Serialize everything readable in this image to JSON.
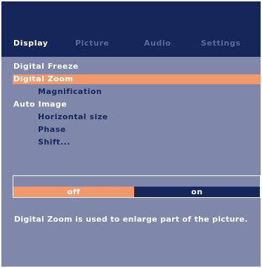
{
  "tabs": [
    {
      "label": "Display",
      "active": true
    },
    {
      "label": "Picture",
      "active": false
    },
    {
      "label": "Audio",
      "active": false
    },
    {
      "label": "Settings",
      "active": false
    }
  ],
  "menu": {
    "items": [
      {
        "label": "Digital Freeze",
        "level": 0,
        "highlighted": false
      },
      {
        "label": "Digital Zoom",
        "level": 0,
        "highlighted": true
      },
      {
        "label": "Magnification",
        "level": 1,
        "highlighted": false
      },
      {
        "label": "Auto Image",
        "level": 0,
        "highlighted": false
      },
      {
        "label": "Horizontal size",
        "level": 1,
        "highlighted": false
      },
      {
        "label": "Phase",
        "level": 1,
        "highlighted": false
      },
      {
        "label": "Shift...",
        "level": 1,
        "highlighted": false
      }
    ]
  },
  "value_selector": {
    "off_label": "off",
    "on_label": "on",
    "selected": "off"
  },
  "help": {
    "text": "Digital Zoom is used to enlarge part of the picture."
  },
  "colors": {
    "header": "#15265a",
    "background": "#7f87ab",
    "highlight": "#f2996b",
    "text": "#ffffff",
    "subitem_text": "#15265a",
    "inactive_tab": "#5d6996"
  }
}
